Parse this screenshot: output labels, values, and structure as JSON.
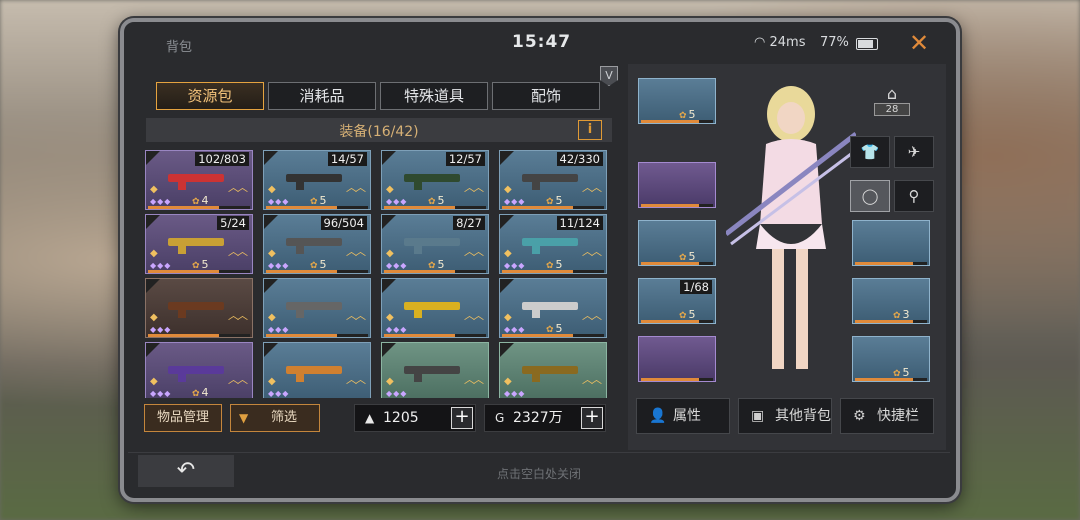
{
  "status": {
    "title": "背包",
    "time": "15:47",
    "ping": "24ms",
    "battery": "77%"
  },
  "tabs": [
    {
      "label": "资源包",
      "active": true
    },
    {
      "label": "消耗品"
    },
    {
      "label": "特殊道具"
    },
    {
      "label": "配饰"
    }
  ],
  "section": {
    "title": "装备(16/42)",
    "info_label": "i",
    "badge": "V"
  },
  "inventory": [
    {
      "count": "102/803",
      "level": "4",
      "rarity": "purple"
    },
    {
      "count": "14/57",
      "level": "5",
      "rarity": "blue"
    },
    {
      "count": "12/57",
      "level": "5",
      "rarity": "blue"
    },
    {
      "count": "42/330",
      "level": "5",
      "rarity": "blue"
    },
    {
      "count": "5/24",
      "level": "5",
      "rarity": "purple"
    },
    {
      "count": "96/504",
      "level": "5",
      "rarity": "blue"
    },
    {
      "count": "8/27",
      "level": "5",
      "rarity": "blue"
    },
    {
      "count": "11/124",
      "level": "5",
      "rarity": "blue"
    },
    {
      "count": "",
      "level": "",
      "rarity": "brown"
    },
    {
      "count": "",
      "level": "",
      "rarity": "blue"
    },
    {
      "count": "",
      "level": "",
      "rarity": "blue"
    },
    {
      "count": "",
      "level": "5",
      "rarity": "blue"
    },
    {
      "count": "",
      "level": "4",
      "rarity": "purple"
    },
    {
      "count": "",
      "level": "",
      "rarity": "blue"
    },
    {
      "count": "",
      "level": "",
      "rarity": "green"
    },
    {
      "count": "",
      "level": "",
      "rarity": "green"
    }
  ],
  "bottom": {
    "manage_label": "物品管理",
    "filter_label": "筛选",
    "currency1": "1205",
    "currency2": "2327万"
  },
  "equip_left": [
    {
      "count": "",
      "level": "5"
    },
    {
      "count": "",
      "level": ""
    },
    {
      "count": "",
      "level": "5"
    },
    {
      "count": "1/68",
      "level": "5"
    },
    {
      "count": "",
      "level": ""
    }
  ],
  "equip_right": [
    {
      "count": "",
      "level": ""
    },
    {
      "count": "",
      "level": "3"
    },
    {
      "count": "",
      "level": "5"
    }
  ],
  "dorm_level": "28",
  "actions": [
    {
      "label": "属性"
    },
    {
      "label": "其他背包"
    },
    {
      "label": "快捷栏"
    }
  ],
  "footer": {
    "hint": "点击空白处关闭"
  }
}
